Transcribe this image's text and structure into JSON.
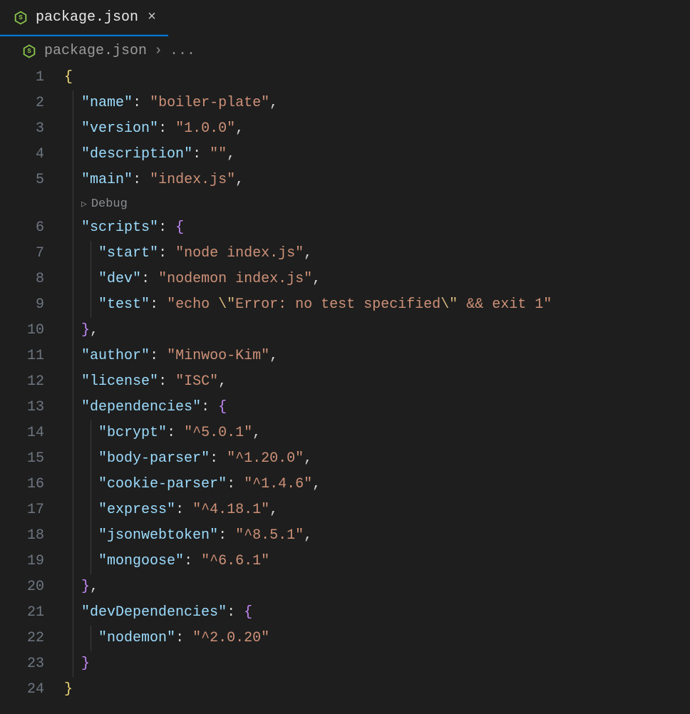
{
  "tab": {
    "filename": "package.json"
  },
  "breadcrumb": {
    "filename": "package.json",
    "separator": "›",
    "rest": "..."
  },
  "codelens": {
    "debug": "Debug"
  },
  "file": {
    "name_key": "name",
    "name_val": "boiler-plate",
    "version_key": "version",
    "version_val": "1.0.0",
    "description_key": "description",
    "description_val": "",
    "main_key": "main",
    "main_val": "index.js",
    "scripts_key": "scripts",
    "scripts": {
      "start_key": "start",
      "start_val": "node index.js",
      "dev_key": "dev",
      "dev_val": "nodemon index.js",
      "test_key": "test",
      "test_val_pre": "echo ",
      "test_val_esc1": "\\\"",
      "test_val_mid": "Error: no test specified",
      "test_val_esc2": "\\\"",
      "test_val_post": " && exit 1"
    },
    "author_key": "author",
    "author_val": "Minwoo-Kim",
    "license_key": "license",
    "license_val": "ISC",
    "dependencies_key": "dependencies",
    "dependencies": {
      "bcrypt_key": "bcrypt",
      "bcrypt_val": "^5.0.1",
      "bodyparser_key": "body-parser",
      "bodyparser_val": "^1.20.0",
      "cookieparser_key": "cookie-parser",
      "cookieparser_val": "^1.4.6",
      "express_key": "express",
      "express_val": "^4.18.1",
      "jsonwebtoken_key": "jsonwebtoken",
      "jsonwebtoken_val": "^8.5.1",
      "mongoose_key": "mongoose",
      "mongoose_val": "^6.6.1"
    },
    "devdeps_key": "devDependencies",
    "devdeps": {
      "nodemon_key": "nodemon",
      "nodemon_val": "^2.0.20"
    }
  },
  "lineNumbers": [
    "1",
    "2",
    "3",
    "4",
    "5",
    "6",
    "7",
    "8",
    "9",
    "10",
    "11",
    "12",
    "13",
    "14",
    "15",
    "16",
    "17",
    "18",
    "19",
    "20",
    "21",
    "22",
    "23",
    "24"
  ]
}
